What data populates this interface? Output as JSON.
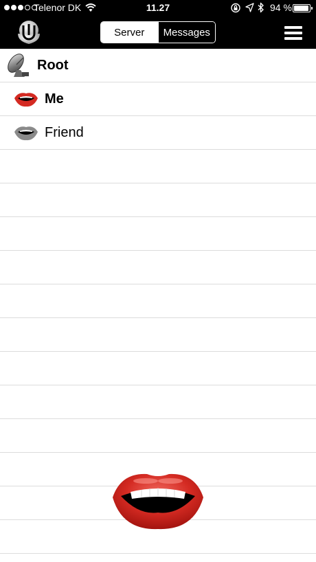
{
  "status_bar": {
    "carrier": "Telenor DK",
    "time": "11.27",
    "battery_text": "94 %",
    "battery_level": 0.94
  },
  "nav": {
    "tabs": [
      {
        "label": "Server",
        "active": true
      },
      {
        "label": "Messages",
        "active": false
      }
    ]
  },
  "list": {
    "items": [
      {
        "label": "Root",
        "icon": "satellite-dish-icon"
      },
      {
        "label": "Me",
        "icon": "red-lips-icon"
      },
      {
        "label": "Friend",
        "icon": "grey-lips-icon"
      }
    ]
  },
  "colors": {
    "bar_background": "#000000",
    "lips_red": "#d42a22",
    "divider": "#dcdcdc"
  }
}
